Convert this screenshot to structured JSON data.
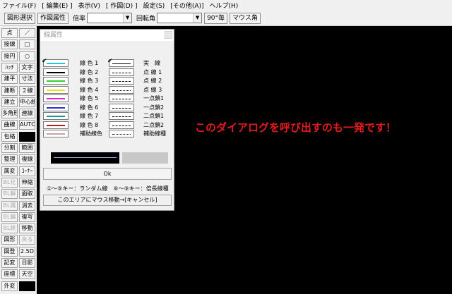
{
  "menu": [
    "ファイル(F)",
    "[ 編集(E) ]",
    "表示(V)",
    "[ 作図(D) ]",
    "設定(S)",
    "[その他(A)]",
    "ヘルプ(H)"
  ],
  "toolbar": {
    "shape_select": "図形選択",
    "draw_attr": "作図属性",
    "scale_label": "倍率",
    "rotation_label": "回転角",
    "deg90": "90°毎",
    "mouse_angle": "マウス角"
  },
  "left_buttons": [
    [
      "点",
      "／"
    ],
    [
      "接線",
      "□"
    ],
    [
      "接円",
      "○"
    ],
    [
      "ﾊｯﾁ",
      "文字"
    ],
    [
      "建平",
      "寸法"
    ],
    [
      "建断",
      "２線"
    ],
    [
      "建立",
      "中心線"
    ],
    [
      "多角形",
      "連線"
    ],
    [
      "曲線",
      "AUTO"
    ],
    [
      "包絡",
      ""
    ],
    [
      "分割",
      "範囲"
    ],
    [
      "整理",
      "複線"
    ],
    [
      "属変",
      "ｺｰﾅｰ"
    ],
    [
      "BL化",
      "伸縮"
    ],
    [
      "BL解",
      "面取"
    ],
    [
      "BL属",
      "消去"
    ],
    [
      "BL編",
      "複写"
    ],
    [
      "BL終",
      "移動"
    ],
    [
      "図形",
      "戻る"
    ],
    [
      "図登",
      "2.5D"
    ],
    [
      "記変",
      "日影"
    ],
    [
      "座標",
      "天空"
    ],
    [
      "外変",
      ""
    ]
  ],
  "dialog": {
    "title": "線属性",
    "color_rows": [
      {
        "label": "線 色 1",
        "color": "#27c4ea",
        "checked": true
      },
      {
        "label": "線 色 2",
        "color": "#000000",
        "checked": false
      },
      {
        "label": "線 色 3",
        "color": "#2fd12f",
        "checked": false
      },
      {
        "label": "線 色 4",
        "color": "#e4e227",
        "checked": false
      },
      {
        "label": "線 色 5",
        "color": "#d92ad9",
        "checked": false
      },
      {
        "label": "線 色 6",
        "color": "#2d2de0",
        "checked": false
      },
      {
        "label": "線 色 7",
        "color": "#1a9a9a",
        "checked": false
      },
      {
        "label": "線 色 8",
        "color": "#b21e1e",
        "checked": false
      },
      {
        "label": "補助線色",
        "color": "#c9a4a4",
        "checked": false
      }
    ],
    "line_rows": [
      {
        "label": "実　線",
        "dash": "solid",
        "checked": true
      },
      {
        "label": "点 線 1",
        "dash": "dashed",
        "checked": false
      },
      {
        "label": "点 線 2",
        "dash": "dashed",
        "checked": false
      },
      {
        "label": "点 線 3",
        "dash": "dotted",
        "checked": false
      },
      {
        "label": "一点鎖1",
        "dash": "dashed",
        "checked": false
      },
      {
        "label": "一点鎖2",
        "dash": "dashed",
        "checked": false
      },
      {
        "label": "二点鎖1",
        "dash": "dashed",
        "checked": false
      },
      {
        "label": "二点鎖2",
        "dash": "dashed",
        "checked": false
      },
      {
        "label": "補助線種",
        "dash": "dotted",
        "checked": false
      }
    ],
    "ok_label": "Ok",
    "key_hint": "①～⑤キー：ランダム線　⑥～⑨キー：倍長線種",
    "mouse_hint": "このエリアにマウス移動→[キャンセル]"
  },
  "annotation": "このダイアログを呼び出すのも一発です！"
}
